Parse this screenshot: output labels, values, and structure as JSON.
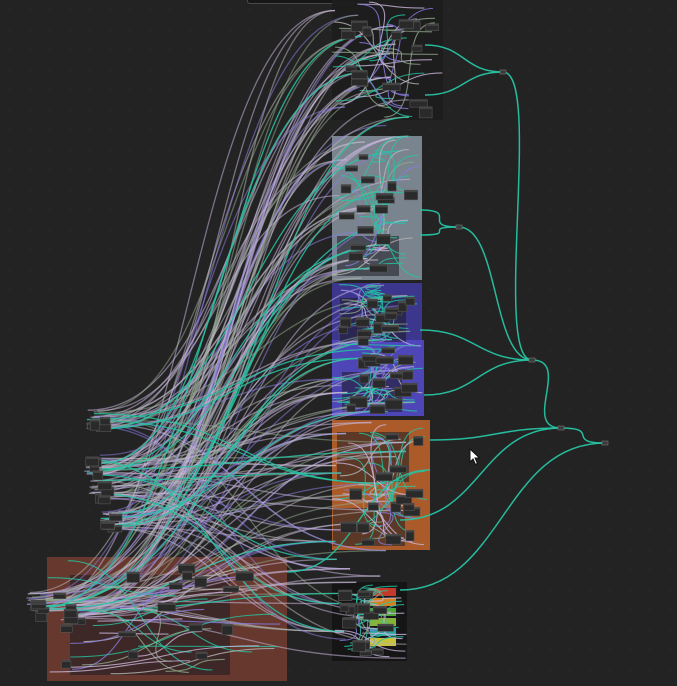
{
  "window": {
    "title_stub": ""
  },
  "colors": {
    "background": "#232323",
    "link_teal": "#27c4a3",
    "link_lavender": "#c9b6dc",
    "link_sage": "#8ea88b",
    "link_grey": "#b6b6b6",
    "link_violet": "#8a7be0",
    "group_grey": "#7f8a95",
    "group_indigo": "#413a9a",
    "group_blue": "#4f46b8",
    "group_orange": "#b15f2a",
    "group_brown": "#6b3a2e",
    "group_dark": "#1b1b1b",
    "node_body": "#2a2a2a",
    "node_border": "#555555"
  },
  "groups": [
    {
      "name": "top-dark-group",
      "color": "#1d1d1d"
    },
    {
      "name": "grey-group",
      "color": "#7f8a95"
    },
    {
      "name": "indigo-group",
      "color": "#3e3893"
    },
    {
      "name": "blue-group",
      "color": "#5148c0"
    },
    {
      "name": "orange-group",
      "color": "#b35f2b"
    },
    {
      "name": "brown-group",
      "color": "#6c3b2f"
    },
    {
      "name": "output-group",
      "color": "#151515"
    }
  ],
  "cursor": {
    "icon": "mouse-pointer-icon"
  }
}
